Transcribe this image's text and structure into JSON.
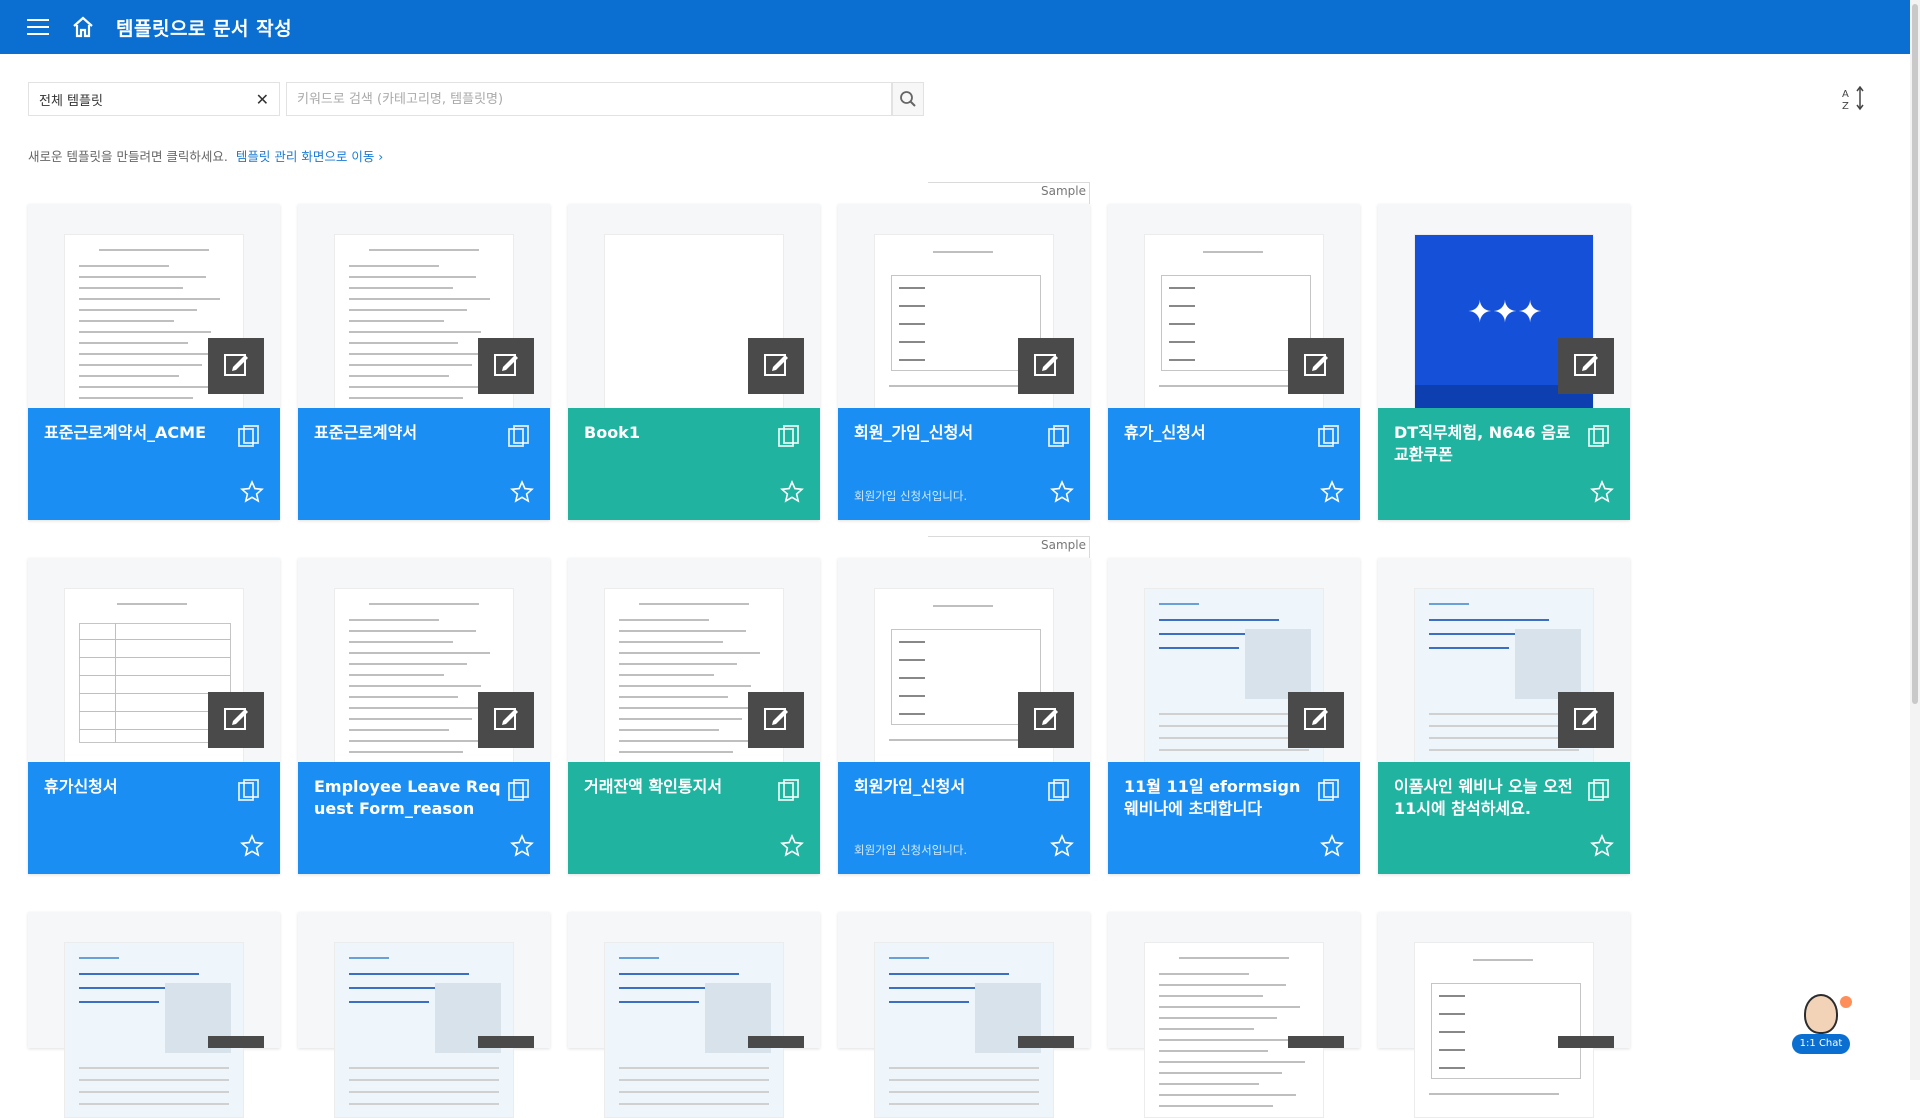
{
  "header": {
    "title": "템플릿으로 문서 작성"
  },
  "filters": {
    "category_value": "전체 템플릿",
    "search_placeholder": "키워드로 검색 (카테고리명, 템플릿명)"
  },
  "hint": {
    "text": "새로운 템플릿을 만들려면 클릭하세요.",
    "link": "템플릿 관리 화면으로 이동 ›"
  },
  "sample_label": "Sample",
  "chat": {
    "label": "1:1 Chat"
  },
  "templates": [
    {
      "name": "표준근로계약서_ACME",
      "desc": "",
      "color": "#1a8ef2",
      "preview": "doc"
    },
    {
      "name": "표준근로계약서",
      "desc": "",
      "color": "#1a8ef2",
      "preview": "doc"
    },
    {
      "name": "Book1",
      "desc": "",
      "color": "#20b3a0",
      "preview": "blank"
    },
    {
      "name": "회원_가입_신청서",
      "desc": "회원가입 신청서입니다.",
      "color": "#1a8ef2",
      "preview": "form",
      "sample": true
    },
    {
      "name": "휴가_신청서",
      "desc": "",
      "color": "#1a8ef2",
      "preview": "form"
    },
    {
      "name": "DT직무체험, N646 음료 교환쿠폰",
      "desc": "",
      "color": "#20b3a0",
      "preview": "poster"
    },
    {
      "name": "휴가신청서",
      "desc": "",
      "color": "#1a8ef2",
      "preview": "table"
    },
    {
      "name": "Employee Leave Request Form_reason",
      "desc": "",
      "color": "#1a8ef2",
      "preview": "doc"
    },
    {
      "name": "거래잔액 확인통지서",
      "desc": "",
      "color": "#20b3a0",
      "preview": "doc"
    },
    {
      "name": "회원가입_신청서",
      "desc": "회원가입 신청서입니다.",
      "color": "#1a8ef2",
      "preview": "form",
      "sample": true
    },
    {
      "name": "11월 11일 eformsign 웨비나에 초대합니다",
      "desc": "",
      "color": "#1a8ef2",
      "preview": "webinar"
    },
    {
      "name": "이폼사인 웨비나 오늘 오전 11시에 참석하세요.",
      "desc": "",
      "color": "#20b3a0",
      "preview": "webinar"
    },
    {
      "name": "",
      "desc": "",
      "color": "#1a8ef2",
      "preview": "webinar"
    },
    {
      "name": "",
      "desc": "",
      "color": "#1a8ef2",
      "preview": "webinar"
    },
    {
      "name": "",
      "desc": "",
      "color": "#20b3a0",
      "preview": "webinar"
    },
    {
      "name": "",
      "desc": "",
      "color": "#1a8ef2",
      "preview": "webinar"
    },
    {
      "name": "",
      "desc": "",
      "color": "#1a8ef2",
      "preview": "doc"
    },
    {
      "name": "",
      "desc": "",
      "color": "#20b3a0",
      "preview": "form"
    }
  ]
}
